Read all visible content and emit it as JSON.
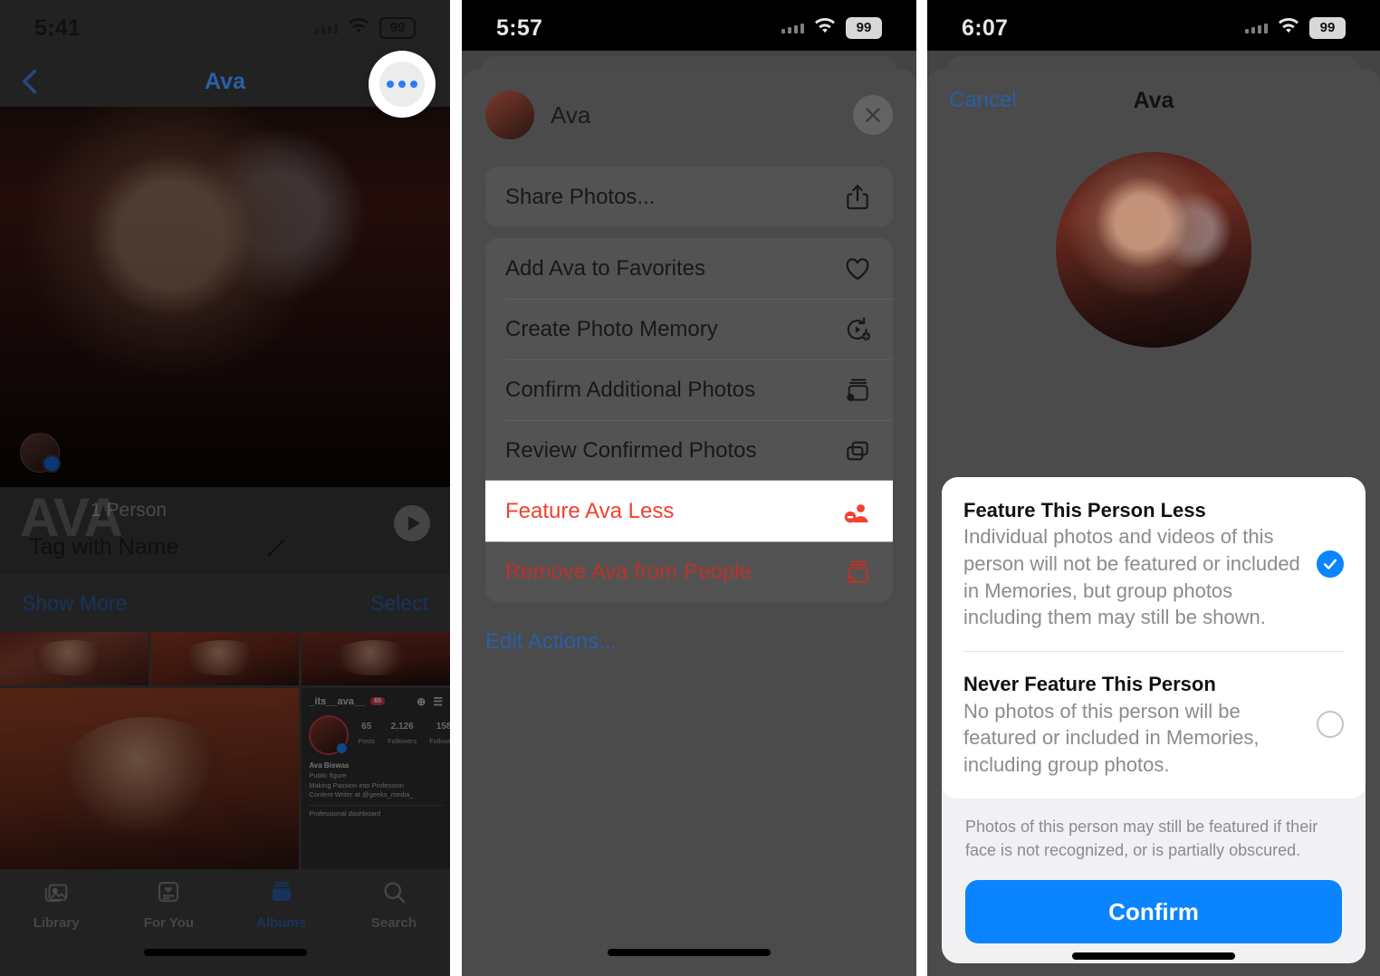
{
  "panels": {
    "left": {
      "status": {
        "time": "5:41",
        "battery": "99",
        "wifi_icon": "wifi-icon",
        "signal_icon": "cellular-signal-icon"
      },
      "navbar": {
        "back_icon": "chevron-left-icon",
        "title": "Ava",
        "more_icon": "more-ellipsis-icon"
      },
      "hero": {
        "face_chip_icon": "face-thumbnail-icon",
        "watermark": "AVA",
        "person_count": "1 Person",
        "tag_label": "Tag with Name",
        "pencil_icon": "pencil-edit-icon",
        "play_icon": "play-icon"
      },
      "actions": {
        "show_more": "Show More",
        "select": "Select"
      },
      "instagram": {
        "handle": "_its__ava__",
        "badge": "65",
        "add_icon": "plus-square-icon",
        "menu_icon": "hamburger-menu-icon",
        "stats": [
          {
            "value": "65",
            "label": "Posts"
          },
          {
            "value": "2,126",
            "label": "Followers"
          },
          {
            "value": "158",
            "label": "Following"
          }
        ],
        "name": "Ava Biswas",
        "category": "Public figure",
        "bio_line1": "Making Passion into Profession",
        "bio_line2": "Content Writer at @geeks_media_",
        "dashboard": "Professional dashboard"
      },
      "tabbar": [
        {
          "label": "Library",
          "icon": "photos-library-icon",
          "active": false
        },
        {
          "label": "For You",
          "icon": "for-you-icon",
          "active": false
        },
        {
          "label": "Albums",
          "icon": "albums-icon",
          "active": true
        },
        {
          "label": "Search",
          "icon": "search-icon",
          "active": false
        }
      ]
    },
    "middle": {
      "status": {
        "time": "5:57",
        "battery": "99"
      },
      "sheet": {
        "person_name": "Ava",
        "avatar_icon": "person-avatar-icon",
        "close_icon": "close-x-icon"
      },
      "menu_groups": [
        [
          {
            "label": "Share Photos...",
            "icon": "share-icon",
            "style": "normal"
          }
        ],
        [
          {
            "label": "Add Ava to Favorites",
            "icon": "heart-icon",
            "style": "normal"
          },
          {
            "label": "Create Photo Memory",
            "icon": "memory-play-icon",
            "style": "normal"
          },
          {
            "label": "Confirm Additional Photos",
            "icon": "confirm-photos-icon",
            "style": "normal"
          },
          {
            "label": "Review Confirmed Photos",
            "icon": "stacked-photos-icon",
            "style": "normal"
          },
          {
            "label": "Feature Ava Less",
            "icon": "feature-less-person-icon",
            "style": "highlight"
          },
          {
            "label": "Remove Ava from People",
            "icon": "remove-person-icon",
            "style": "destructive"
          }
        ]
      ],
      "edit_actions": "Edit Actions..."
    },
    "right": {
      "status": {
        "time": "6:07",
        "battery": "99"
      },
      "navbar": {
        "cancel": "Cancel",
        "title": "Ava"
      },
      "avatar_icon": "person-avatar-large-icon",
      "options": [
        {
          "title": "Feature This Person Less",
          "desc": "Individual photos and videos of this person will not be featured or included in Memories, but group photos including them may still be shown.",
          "selected": true
        },
        {
          "title": "Never Feature This Person",
          "desc": "No photos of this person will be featured or included in Memories, including group photos.",
          "selected": false
        }
      ],
      "footnote": "Photos of this person may still be featured if their face is not recognized, or is partially obscured.",
      "confirm_label": "Confirm"
    }
  },
  "colors": {
    "accent_blue": "#0a84ff",
    "link_blue": "#2a5ea8",
    "destructive_red": "#b9332b",
    "highlight_red": "#f3402f"
  }
}
